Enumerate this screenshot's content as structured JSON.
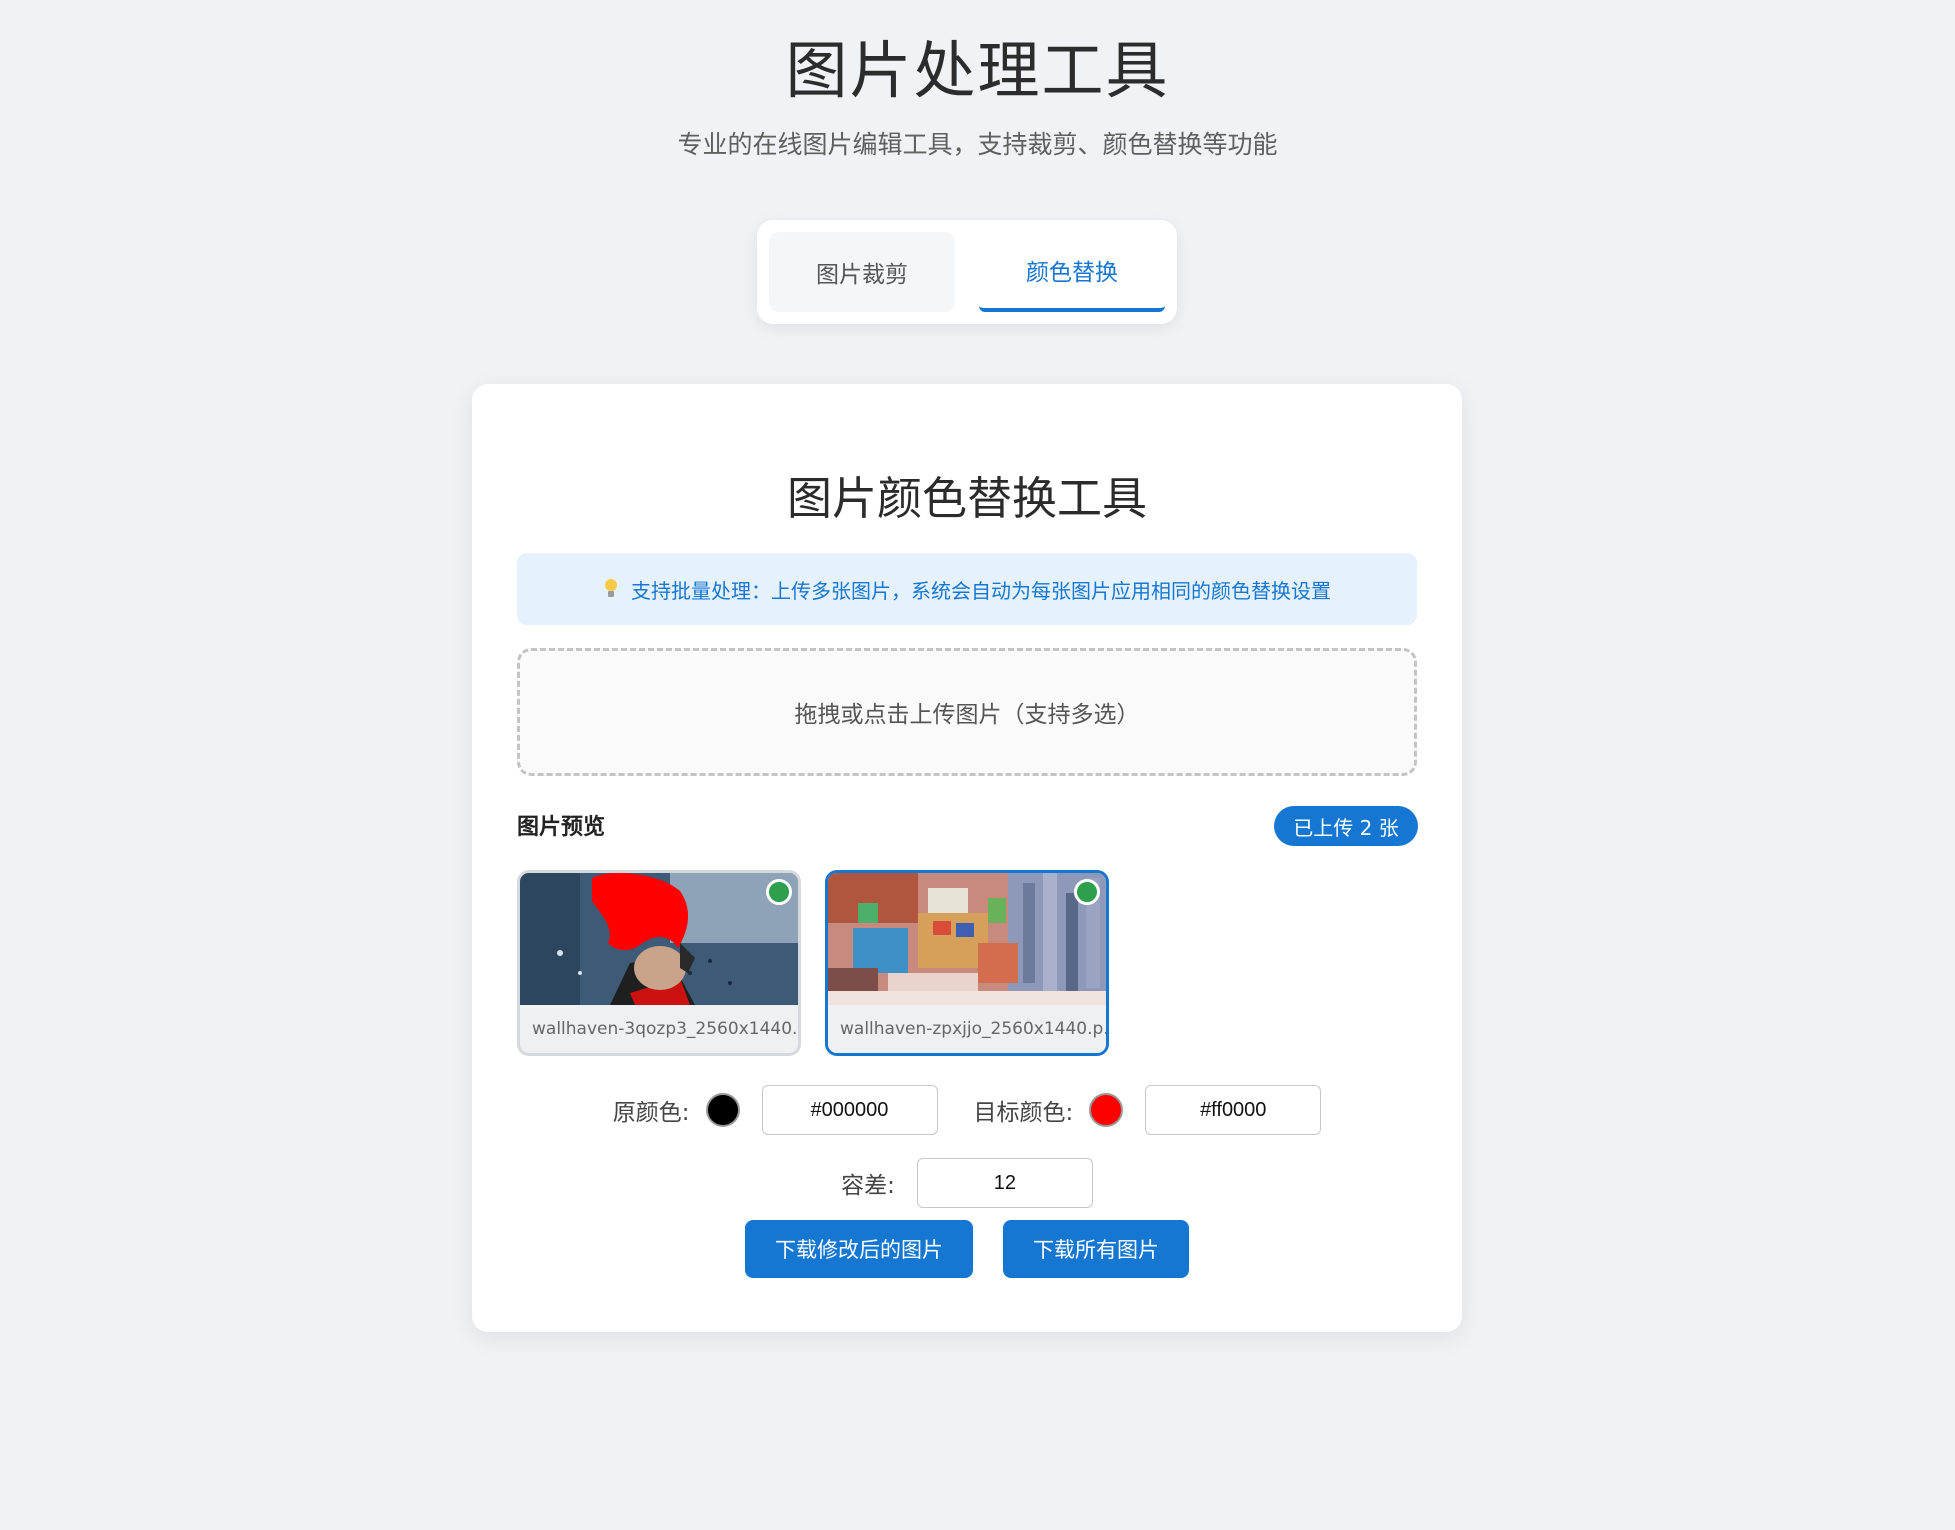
{
  "header": {
    "title": "图片处理工具",
    "subtitle": "专业的在线图片编辑工具，支持裁剪、颜色替换等功能"
  },
  "tabs": [
    {
      "label": "图片裁剪",
      "active": false
    },
    {
      "label": "颜色替换",
      "active": true
    }
  ],
  "card": {
    "title": "图片颜色替换工具",
    "info": {
      "icon": "lightbulb-icon",
      "text": "支持批量处理：上传多张图片，系统会自动为每张图片应用相同的颜色替换设置"
    },
    "dropzone_text": "拖拽或点击上传图片（支持多选）",
    "preview_label": "图片预览",
    "upload_count": "已上传 2 张",
    "images": [
      {
        "filename": "wallhaven-3qozp3_2560x1440...",
        "selected": false,
        "status": "processed"
      },
      {
        "filename": "wallhaven-zpxjjo_2560x1440.p...",
        "selected": true,
        "status": "processed"
      }
    ],
    "controls": {
      "source_label": "原颜色:",
      "source_color": "#000000",
      "source_value": "#000000",
      "target_label": "目标颜色:",
      "target_color": "#ff0000",
      "target_value": "#ff0000",
      "tolerance_label": "容差:",
      "tolerance_value": "12"
    },
    "buttons": {
      "download_modified": "下载修改后的图片",
      "download_all": "下载所有图片"
    }
  },
  "colors": {
    "accent": "#1677d2",
    "background": "#f0f2f5",
    "info_bg": "#e5f2fd",
    "status_ok": "#2e9f4c"
  }
}
